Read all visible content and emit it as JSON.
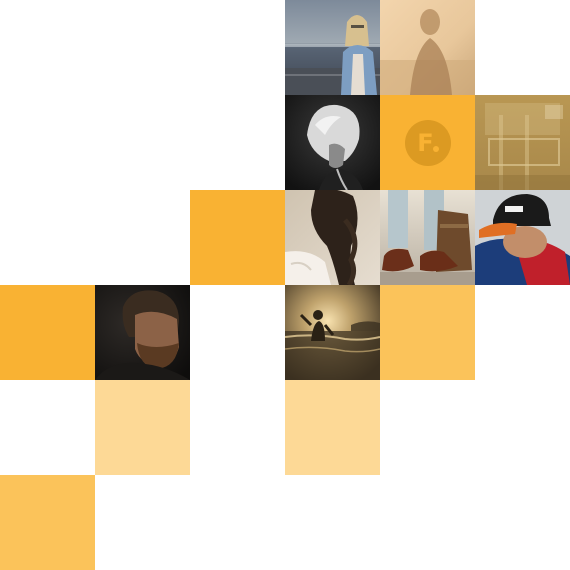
{
  "colors": {
    "accent": "#F9B233",
    "accent_soft": "#FBC35A",
    "accent_pale": "#FDD996",
    "logo_mark": "#DC9A22",
    "logo_glyph": "#F9B233"
  },
  "logo": {
    "letter": "F",
    "icon": "brand-logo-icon"
  },
  "grid": {
    "cols": 6,
    "rows": 6
  },
  "tiles": [
    {
      "name": "photo-woman-denim-jacket",
      "kind": "photo",
      "col": 3,
      "row": 0
    },
    {
      "name": "photo-silhouette-sea-warm",
      "kind": "photo",
      "col": 4,
      "row": 0
    },
    {
      "name": "photo-woman-wavy-hair-bw",
      "kind": "photo",
      "col": 3,
      "row": 1
    },
    {
      "name": "brand-logo-tile",
      "kind": "logo",
      "col": 4,
      "row": 1
    },
    {
      "name": "photo-vintage-room",
      "kind": "photo",
      "col": 5,
      "row": 1
    },
    {
      "name": "accent-tile",
      "kind": "solid",
      "tone": "accent",
      "col": 2,
      "row": 2
    },
    {
      "name": "photo-woman-long-hair",
      "kind": "photo",
      "col": 3,
      "row": 2
    },
    {
      "name": "photo-shoes-and-bag",
      "kind": "photo",
      "col": 4,
      "row": 2
    },
    {
      "name": "photo-man-snapback-cap",
      "kind": "photo",
      "col": 5,
      "row": 2
    },
    {
      "name": "accent-tile",
      "kind": "solid",
      "tone": "accent",
      "col": 0,
      "row": 3
    },
    {
      "name": "photo-bearded-man-portrait",
      "kind": "photo",
      "col": 1,
      "row": 3
    },
    {
      "name": "photo-child-sea-sunset",
      "kind": "photo",
      "col": 3,
      "row": 3
    },
    {
      "name": "accent-tile",
      "kind": "solid",
      "tone": "accent_soft",
      "col": 4,
      "row": 3
    },
    {
      "name": "accent-tile",
      "kind": "solid",
      "tone": "accent_pale",
      "col": 1,
      "row": 4
    },
    {
      "name": "accent-tile",
      "kind": "solid",
      "tone": "accent_pale",
      "col": 3,
      "row": 4
    },
    {
      "name": "accent-tile",
      "kind": "solid",
      "tone": "accent_soft",
      "col": 0,
      "row": 5
    }
  ]
}
